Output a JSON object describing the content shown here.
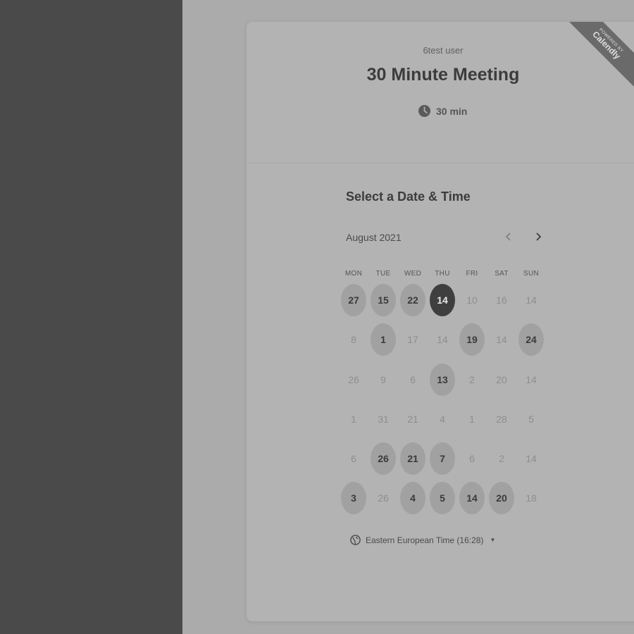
{
  "header": {
    "owner": "6test user",
    "title": "30 Minute Meeting",
    "duration": "30 min",
    "icon": "clock-icon"
  },
  "badge": {
    "line1": "POWERED BY",
    "brand": "Calendly"
  },
  "calendar": {
    "section_title": "Select a Date & Time",
    "month": "August 2021",
    "prev_icon": "chevron-left-icon",
    "next_icon": "chevron-right-icon",
    "weekdays": [
      "MON",
      "TUE",
      "WED",
      "THU",
      "FRI",
      "SAT",
      "SUN"
    ],
    "weeks": [
      [
        {
          "label": "27",
          "state": "available"
        },
        {
          "label": "15",
          "state": "available"
        },
        {
          "label": "22",
          "state": "available"
        },
        {
          "label": "14",
          "state": "selected"
        },
        {
          "label": "10",
          "state": "disabled"
        },
        {
          "label": "16",
          "state": "disabled"
        },
        {
          "label": "14",
          "state": "disabled"
        }
      ],
      [
        {
          "label": "8",
          "state": "disabled"
        },
        {
          "label": "1",
          "state": "available"
        },
        {
          "label": "17",
          "state": "disabled"
        },
        {
          "label": "14",
          "state": "disabled"
        },
        {
          "label": "19",
          "state": "available"
        },
        {
          "label": "14",
          "state": "disabled"
        },
        {
          "label": "24",
          "state": "available"
        }
      ],
      [
        {
          "label": "26",
          "state": "disabled"
        },
        {
          "label": "9",
          "state": "disabled"
        },
        {
          "label": "6",
          "state": "disabled"
        },
        {
          "label": "13",
          "state": "available"
        },
        {
          "label": "2",
          "state": "disabled"
        },
        {
          "label": "20",
          "state": "disabled"
        },
        {
          "label": "14",
          "state": "disabled"
        }
      ],
      [
        {
          "label": "1",
          "state": "disabled"
        },
        {
          "label": "31",
          "state": "disabled"
        },
        {
          "label": "21",
          "state": "disabled"
        },
        {
          "label": "4",
          "state": "disabled"
        },
        {
          "label": "1",
          "state": "disabled"
        },
        {
          "label": "28",
          "state": "disabled"
        },
        {
          "label": "5",
          "state": "disabled"
        }
      ],
      [
        {
          "label": "6",
          "state": "disabled"
        },
        {
          "label": "26",
          "state": "available"
        },
        {
          "label": "21",
          "state": "available"
        },
        {
          "label": "7",
          "state": "available"
        },
        {
          "label": "6",
          "state": "disabled"
        },
        {
          "label": "2",
          "state": "disabled"
        },
        {
          "label": "14",
          "state": "disabled"
        }
      ],
      [
        {
          "label": "3",
          "state": "available"
        },
        {
          "label": "26",
          "state": "disabled"
        },
        {
          "label": "4",
          "state": "available"
        },
        {
          "label": "5",
          "state": "available"
        },
        {
          "label": "14",
          "state": "available"
        },
        {
          "label": "20",
          "state": "available"
        },
        {
          "label": "18",
          "state": "disabled"
        }
      ]
    ]
  },
  "timezone": {
    "label": "Eastern European Time (16:28)",
    "icon": "globe-icon",
    "caret_icon": "caret-down-icon"
  },
  "colors": {
    "sidebar": "#4a4a4a",
    "page_bg": "#ababab",
    "card_bg": "#b3b3b3",
    "selected_day": "#3f3f3f",
    "available_day": "#a1a1a1"
  }
}
